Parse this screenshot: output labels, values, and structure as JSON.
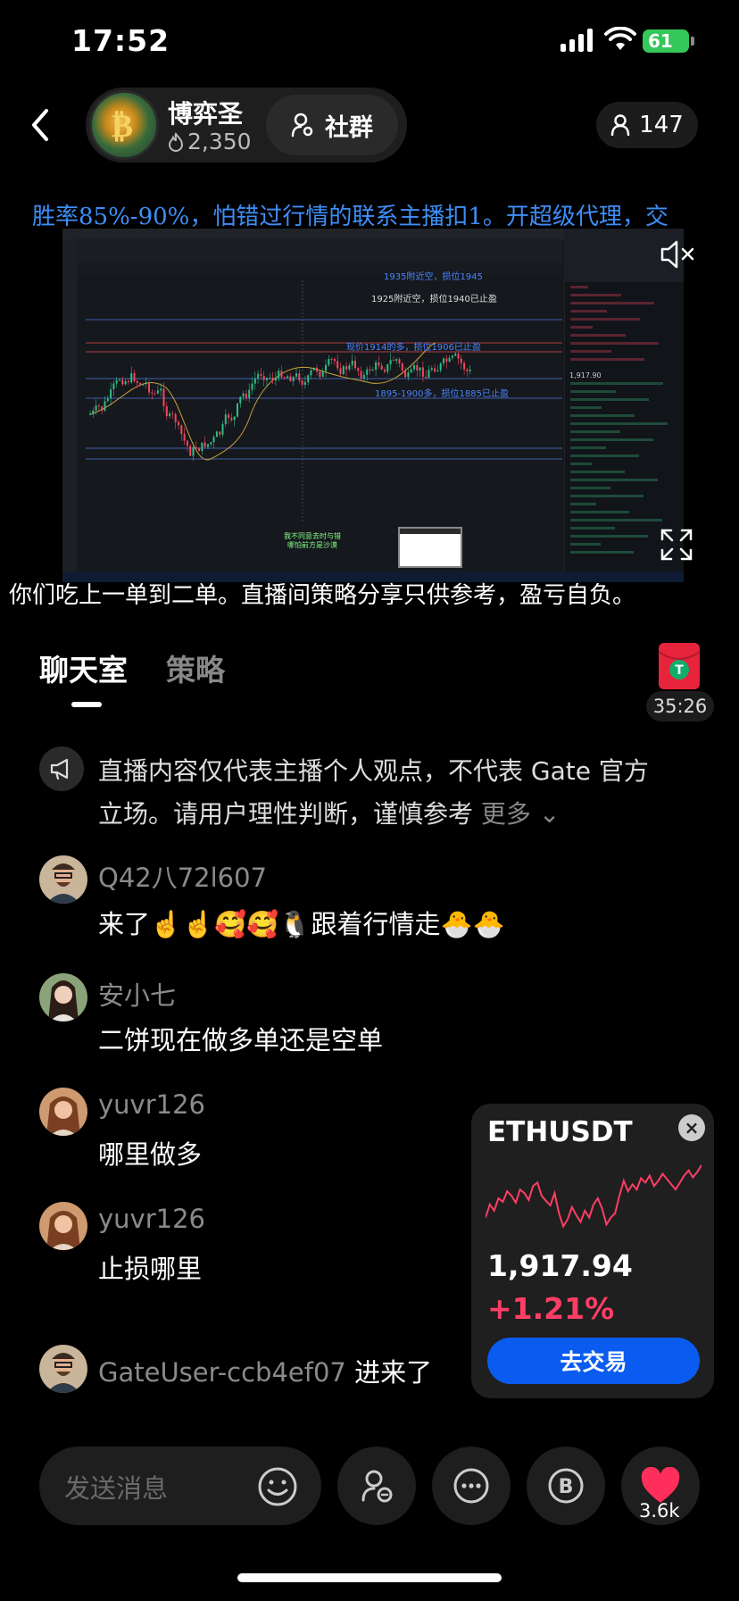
{
  "status_bar": {
    "time": "17:52",
    "battery": "61"
  },
  "header": {
    "host_name": "博弈圣",
    "heat": "2,350",
    "community_label": "社群",
    "viewers": "147"
  },
  "video": {
    "marquee": "胜率85%-90%，怕错过行情的联系主播扣1。开超级代理，交",
    "caption": "你们吃上一单到二单。直播间策略分享只供参考，盈亏自负。",
    "chart_labels": {
      "l1": "1935附近空，损位1945",
      "l2": "1925附近空，损位1940已止盈",
      "l3": "现价1914的多，损位1906已止盈",
      "l4": "1895-1900多，损位1885已止盈"
    },
    "orderbook_price": "1,917.90",
    "subtitle_line1": "我不同意去时与错",
    "subtitle_line2": "哪怕前方是沙漠"
  },
  "tabs": {
    "chat": "聊天室",
    "strategy": "策略"
  },
  "timer": "35:26",
  "notice": {
    "text": "直播内容仅代表主播个人观点，不代表 Gate 官方立场。请用户理性判断，谨慎参考",
    "more": "更多"
  },
  "messages": [
    {
      "user": "Q42八72l607",
      "text": "来了☝️☝️🥰🥰🐧跟着行情走🐣🐣"
    },
    {
      "user": "安小七",
      "text": "二饼现在做多单还是空单"
    },
    {
      "user": "yuvr126",
      "text": "哪里做多"
    },
    {
      "user": "yuvr126",
      "text": "止损哪里"
    },
    {
      "user": "GateUser-ccb4ef07",
      "text": "进来了"
    }
  ],
  "ticker": {
    "symbol": "ETHUSDT",
    "price": "1,917.94",
    "change": "+1.21%",
    "trade_label": "去交易",
    "sparkline": [
      0.3,
      0.45,
      0.38,
      0.52,
      0.48,
      0.6,
      0.55,
      0.47,
      0.62,
      0.58,
      0.5,
      0.66,
      0.7,
      0.55,
      0.49,
      0.44,
      0.58,
      0.35,
      0.2,
      0.28,
      0.42,
      0.33,
      0.25,
      0.38,
      0.3,
      0.45,
      0.52,
      0.4,
      0.22,
      0.3,
      0.35,
      0.55,
      0.72,
      0.6,
      0.68,
      0.62,
      0.75,
      0.7,
      0.78,
      0.66,
      0.72,
      0.8,
      0.74,
      0.68,
      0.62,
      0.7,
      0.78,
      0.84,
      0.76,
      0.82,
      0.9
    ],
    "colors": {
      "line": "#ff3e66",
      "button": "#0a5cf0"
    }
  },
  "input": {
    "placeholder": "发送消息"
  },
  "likes": "3.6k"
}
